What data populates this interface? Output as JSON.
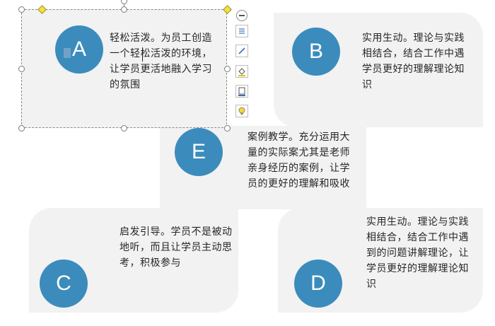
{
  "cards": {
    "a": {
      "letter": "A",
      "text": "轻松活泼。为员工创造一个轻松活泼的环境，让学员更活地融入学习的氛围"
    },
    "b": {
      "letter": "B",
      "text": "实用生动。理论与实践相结合，结合工作中遇学员更好的理解理论知识"
    },
    "e": {
      "letter": "E",
      "text": "案例教学。充分运用大量的实际案尤其是老师亲身经历的案例，让学员的更好的理解和吸收"
    },
    "c": {
      "letter": "C",
      "text": "启发引导。学员不是被动地听，而且让学员主动思考，积极参与"
    },
    "d": {
      "letter": "D",
      "text": "实用生动。理论与实践相结合，结合工作中遇到的问题讲解理论，让学员更好的理解理论知识"
    }
  },
  "toolbar": {
    "items": [
      "minus-icon",
      "layout-options-icon",
      "pen-icon",
      "fill-icon",
      "outline-icon",
      "lightbulb-icon"
    ]
  },
  "colors": {
    "accent": "#3b8cbc",
    "card_bg": "#f2f2f2"
  }
}
